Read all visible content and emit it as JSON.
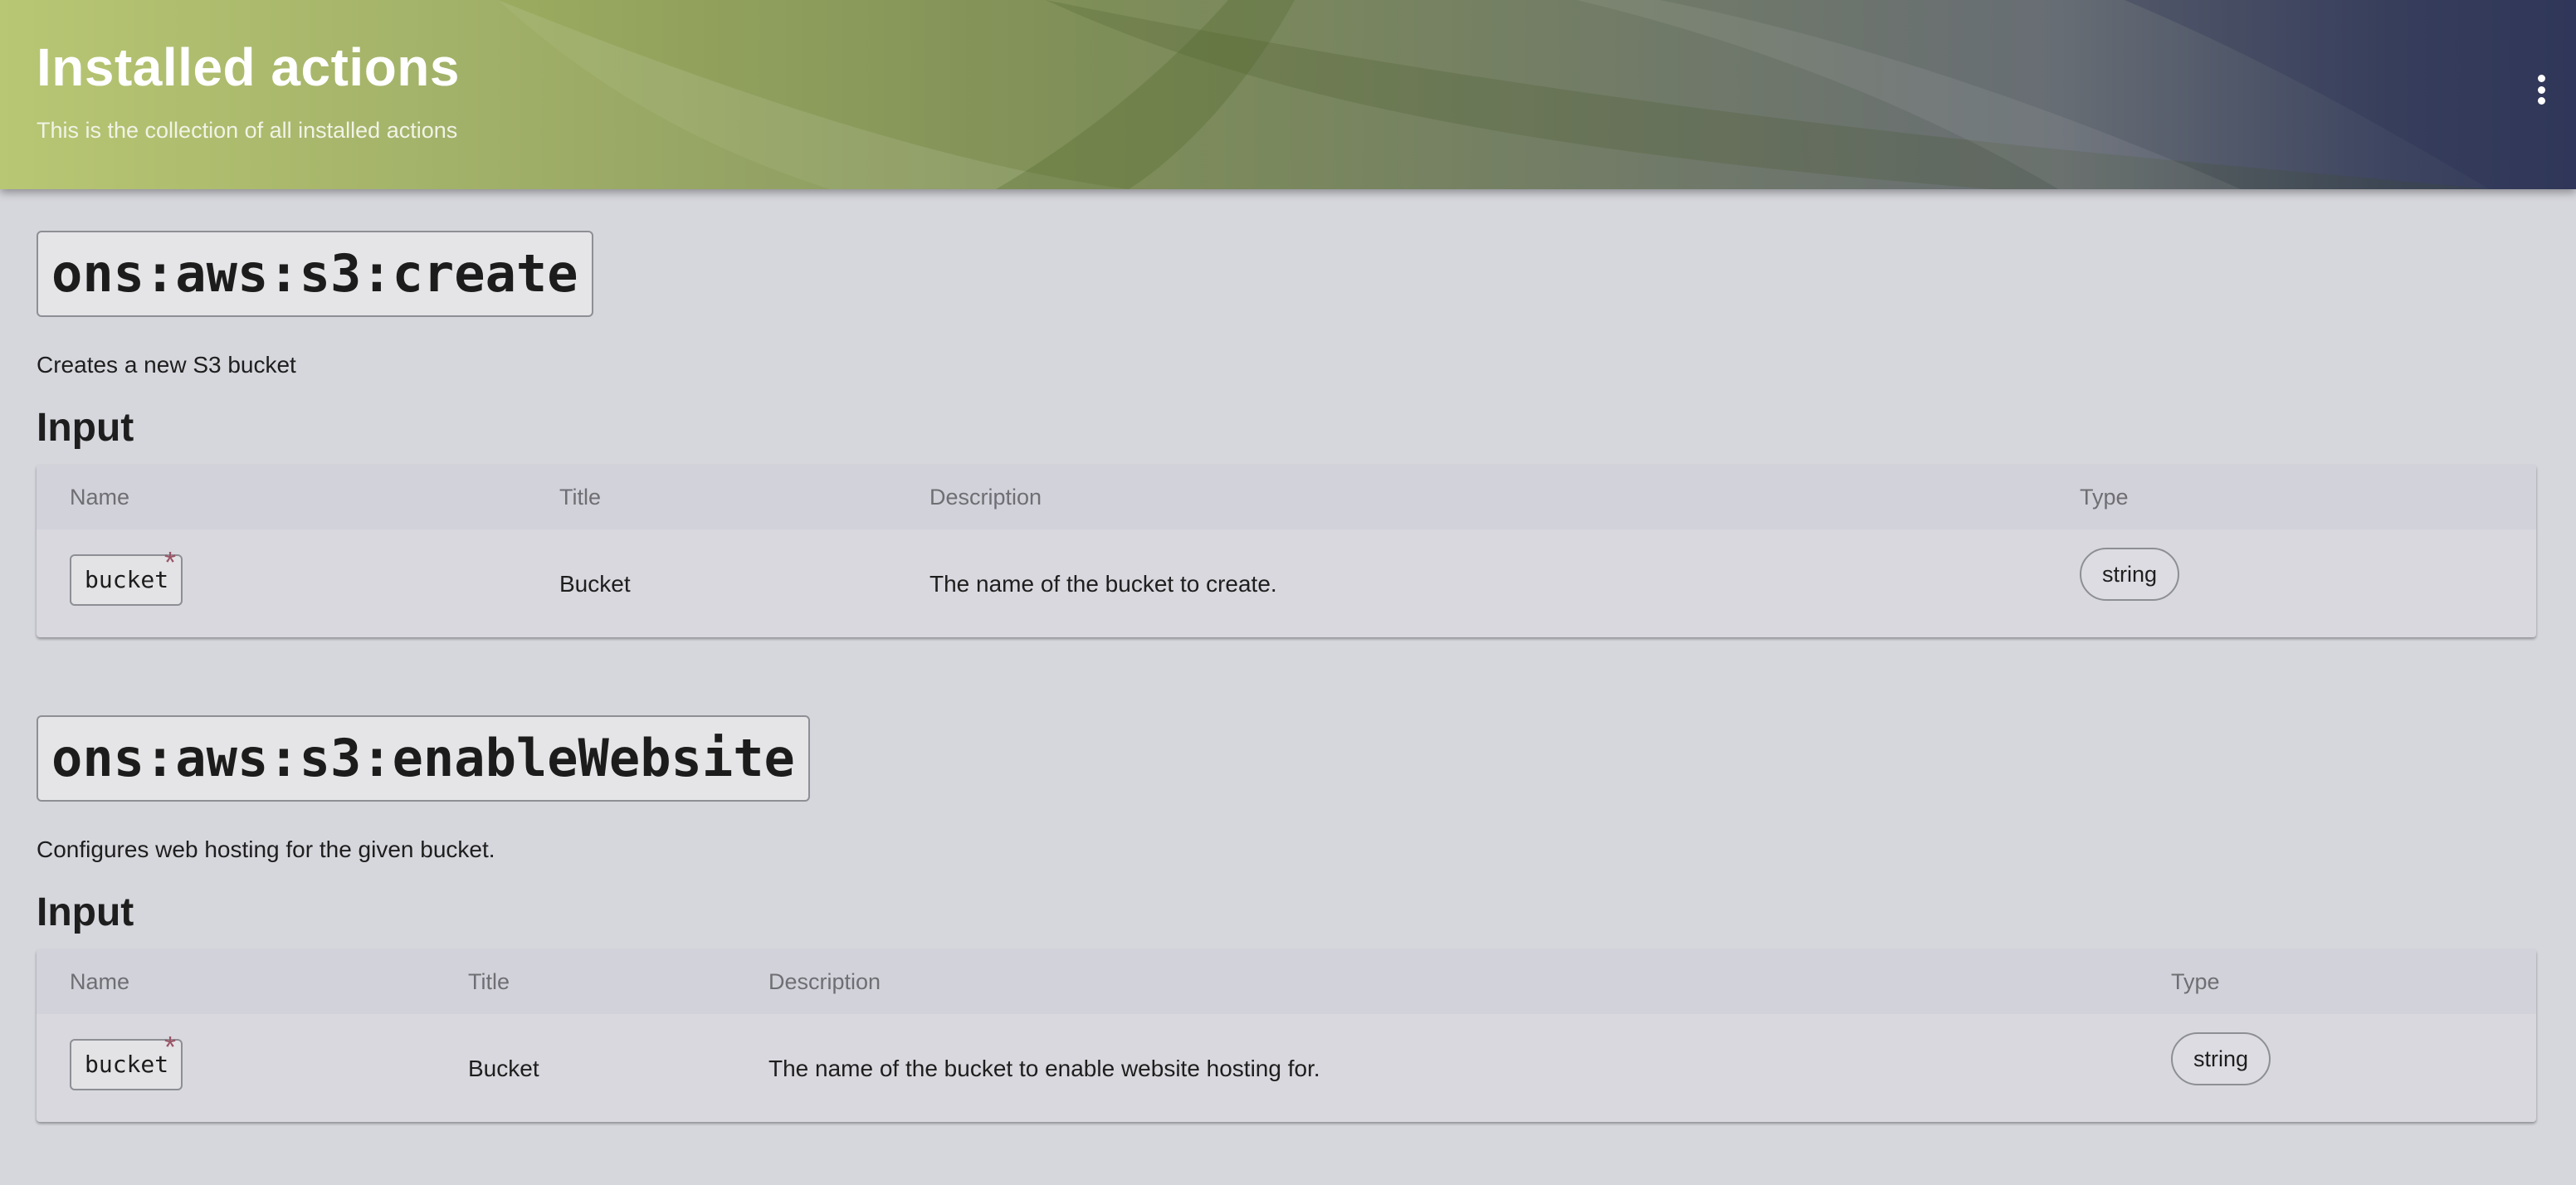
{
  "header": {
    "title": "Installed actions",
    "subtitle": "This is the collection of all installed actions",
    "menu_icon": "more-vertical-icon"
  },
  "colors": {
    "header_gradient_start": "#b4c46c",
    "header_gradient_end": "#323a5c",
    "page_background": "#d6d7dd",
    "required_mark": "#9a5466"
  },
  "actions": [
    {
      "name": "ons:aws:s3:create",
      "description": "Creates a new S3 bucket",
      "input_heading": "Input",
      "columns": [
        "Name",
        "Title",
        "Description",
        "Type"
      ],
      "rows": [
        {
          "name": "bucket",
          "required_mark": "*",
          "title": "Bucket",
          "description": "The name of the bucket to create.",
          "type": "string"
        }
      ]
    },
    {
      "name": "ons:aws:s3:enableWebsite",
      "description": "Configures web hosting for the given bucket.",
      "input_heading": "Input",
      "columns": [
        "Name",
        "Title",
        "Description",
        "Type"
      ],
      "rows": [
        {
          "name": "bucket",
          "required_mark": "*",
          "title": "Bucket",
          "description": "The name of the bucket to enable website hosting for.",
          "type": "string"
        }
      ]
    }
  ]
}
